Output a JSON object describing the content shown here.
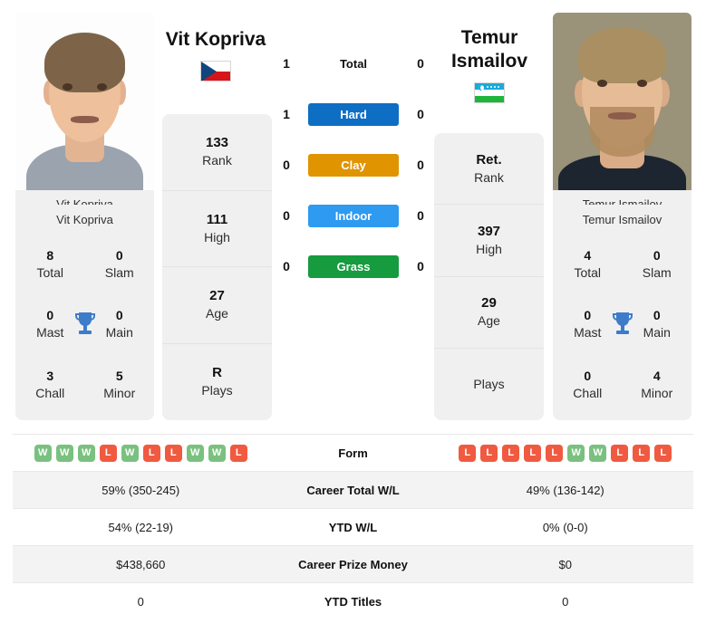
{
  "players": {
    "left": {
      "name": "Vit Kopriva",
      "photo_name": "Vit Kopriva",
      "country_flag": "czech-republic-flag",
      "rank": "133",
      "rank_label": "Rank",
      "high": "111",
      "high_label": "High",
      "age": "27",
      "age_label": "Age",
      "plays": "R",
      "plays_label": "Plays",
      "titles": {
        "total": "8",
        "total_label": "Total",
        "slam": "0",
        "slam_label": "Slam",
        "mast": "0",
        "mast_label": "Mast",
        "main": "0",
        "main_label": "Main",
        "chall": "3",
        "chall_label": "Chall",
        "minor": "5",
        "minor_label": "Minor"
      },
      "form": [
        "W",
        "W",
        "W",
        "L",
        "W",
        "L",
        "L",
        "W",
        "W",
        "L"
      ],
      "career_wl": "59% (350-245)",
      "ytd_wl": "54% (22-19)",
      "prize_money": "$438,660",
      "ytd_titles": "0"
    },
    "right": {
      "name": "Temur Ismailov",
      "name_line1": "Temur",
      "name_line2": "Ismailov",
      "photo_name": "Temur Ismailov",
      "country_flag": "uzbekistan-flag",
      "rank": "Ret.",
      "rank_label": "Rank",
      "high": "397",
      "high_label": "High",
      "age": "29",
      "age_label": "Age",
      "plays": "",
      "plays_label": "Plays",
      "titles": {
        "total": "4",
        "total_label": "Total",
        "slam": "0",
        "slam_label": "Slam",
        "mast": "0",
        "mast_label": "Mast",
        "main": "0",
        "main_label": "Main",
        "chall": "0",
        "chall_label": "Chall",
        "minor": "4",
        "minor_label": "Minor"
      },
      "form": [
        "L",
        "L",
        "L",
        "L",
        "L",
        "W",
        "W",
        "L",
        "L",
        "L"
      ],
      "career_wl": "49% (136-142)",
      "ytd_wl": "0% (0-0)",
      "prize_money": "$0",
      "ytd_titles": "0"
    }
  },
  "h2h": {
    "rows": [
      {
        "label": "Total",
        "left": "1",
        "right": "0",
        "badge": false,
        "color": ""
      },
      {
        "label": "Hard",
        "left": "1",
        "right": "0",
        "badge": true,
        "color": "#0d6ec4"
      },
      {
        "label": "Clay",
        "left": "0",
        "right": "0",
        "badge": true,
        "color": "#e09400"
      },
      {
        "label": "Indoor",
        "left": "0",
        "right": "0",
        "badge": true,
        "color": "#2e9af0"
      },
      {
        "label": "Grass",
        "left": "0",
        "right": "0",
        "badge": true,
        "color": "#169b3e"
      }
    ]
  },
  "table": {
    "rows": [
      {
        "label": "Form",
        "type": "form"
      },
      {
        "label": "Career Total W/L",
        "type": "text",
        "key": "career_wl"
      },
      {
        "label": "YTD W/L",
        "type": "text",
        "key": "ytd_wl"
      },
      {
        "label": "Career Prize Money",
        "type": "text",
        "key": "prize_money"
      },
      {
        "label": "YTD Titles",
        "type": "text",
        "key": "ytd_titles"
      }
    ]
  },
  "colors": {
    "win_badge": "#7ac17f",
    "loss_badge": "#f05a40",
    "card_bg": "#f0f0f0",
    "trophy": "#3d7cc9"
  }
}
